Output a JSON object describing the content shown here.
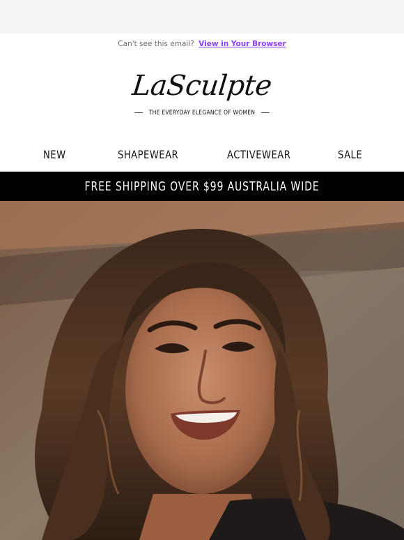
{
  "preheader": {
    "text": "Can't see this email?",
    "link_label": "View in Your Browser"
  },
  "brand": {
    "logo_text": "LaSculpte",
    "tagline": "THE EVERYDAY ELEGANCE OF WOMEN"
  },
  "nav": {
    "items": [
      {
        "label": "NEW"
      },
      {
        "label": "SHAPEWEAR"
      },
      {
        "label": "ACTIVEWEAR"
      },
      {
        "label": "SALE"
      }
    ]
  },
  "banner": {
    "text": "FREE SHIPPING OVER $99 AUSTRALIA WIDE"
  },
  "colors": {
    "link": "#8a3ffc",
    "banner_bg": "#000000",
    "page_bg": "#f5f5f3"
  }
}
